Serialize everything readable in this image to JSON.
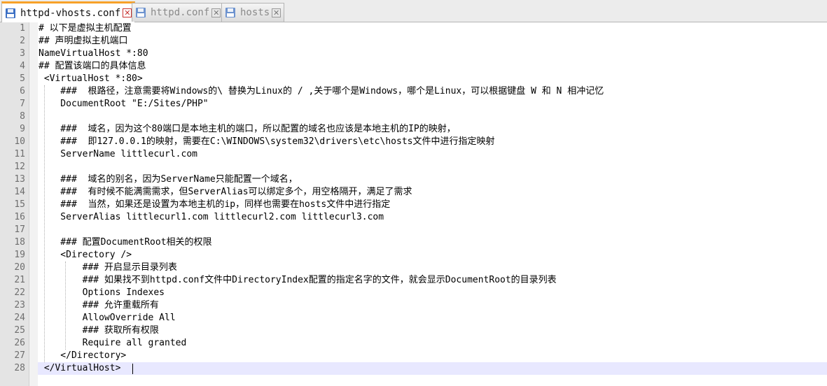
{
  "tabs": [
    {
      "label": "httpd-vhosts.conf",
      "active": true
    },
    {
      "label": "httpd.conf",
      "active": false
    },
    {
      "label": "hosts",
      "active": false
    }
  ],
  "icons": {
    "file": "floppy-disk-icon",
    "close": "close-x-icon"
  },
  "colors": {
    "active_tab_accent": "#f7a128",
    "current_line": "#e8e8ff",
    "close_active": "#c8322f"
  },
  "editor": {
    "current_line": 28,
    "lines": [
      {
        "n": "1",
        "text": "# 以下是虚拟主机配置"
      },
      {
        "n": "2",
        "text": "## 声明虚拟主机端口"
      },
      {
        "n": "3",
        "text": "NameVirtualHost *:80"
      },
      {
        "n": "4",
        "text": "## 配置该端口的具体信息"
      },
      {
        "n": "5",
        "text": " <VirtualHost *:80>"
      },
      {
        "n": "6",
        "text": "    ###  根路径，注意需要将Windows的\\ 替换为Linux的 / ,关于哪个是Windows，哪个是Linux，可以根据键盘 W 和 N 相冲记忆"
      },
      {
        "n": "7",
        "text": "    DocumentRoot \"E:/Sites/PHP\""
      },
      {
        "n": "8",
        "text": ""
      },
      {
        "n": "9",
        "text": "    ###  域名，因为这个80端口是本地主机的端口，所以配置的域名也应该是本地主机的IP的映射，"
      },
      {
        "n": "10",
        "text": "    ###  即127.0.0.1的映射，需要在C:\\WINDOWS\\system32\\drivers\\etc\\hosts文件中进行指定映射"
      },
      {
        "n": "11",
        "text": "    ServerName littlecurl.com"
      },
      {
        "n": "12",
        "text": ""
      },
      {
        "n": "13",
        "text": "    ###  域名的别名，因为ServerName只能配置一个域名，"
      },
      {
        "n": "14",
        "text": "    ###  有时候不能满需需求，但ServerAlias可以绑定多个，用空格隔开，满足了需求"
      },
      {
        "n": "15",
        "text": "    ###  当然，如果还是设置为本地主机的ip，同样也需要在hosts文件中进行指定"
      },
      {
        "n": "16",
        "text": "    ServerAlias littlecurl1.com littlecurl2.com littlecurl3.com"
      },
      {
        "n": "17",
        "text": ""
      },
      {
        "n": "18",
        "text": "    ### 配置DocumentRoot相关的权限"
      },
      {
        "n": "19",
        "text": "    <Directory />"
      },
      {
        "n": "20",
        "text": "        ### 开启显示目录列表"
      },
      {
        "n": "21",
        "text": "        ### 如果找不到httpd.conf文件中DirectoryIndex配置的指定名字的文件，就会显示DocumentRoot的目录列表"
      },
      {
        "n": "22",
        "text": "        Options Indexes"
      },
      {
        "n": "23",
        "text": "        ### 允许重载所有"
      },
      {
        "n": "24",
        "text": "        AllowOverride All"
      },
      {
        "n": "25",
        "text": "        ### 获取所有权限"
      },
      {
        "n": "26",
        "text": "        Require all granted"
      },
      {
        "n": "27",
        "text": "    </Directory>"
      },
      {
        "n": "28",
        "text": " </VirtualHost>"
      }
    ]
  }
}
